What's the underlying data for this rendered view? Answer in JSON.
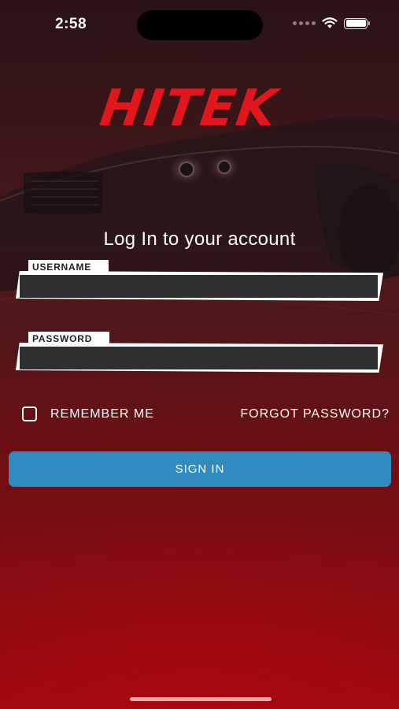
{
  "status_bar": {
    "time": "2:58",
    "icons": [
      "signal-dots-icon",
      "wifi-icon",
      "battery-icon"
    ]
  },
  "logo": {
    "text": "HITEK",
    "color": "#e0171d"
  },
  "login": {
    "heading": "Log In to your account",
    "username": {
      "label": "USERNAME",
      "value": ""
    },
    "password": {
      "label": "PASSWORD",
      "value": ""
    },
    "remember_me": {
      "label": "REMEMBER ME",
      "checked": false
    },
    "forgot_password": "FORGOT PASSWORD?",
    "sign_in": "SIGN IN"
  },
  "colors": {
    "accent_button": "#2f8bc0",
    "brand_red": "#e0171d",
    "input_bg": "#2f2f2f"
  }
}
